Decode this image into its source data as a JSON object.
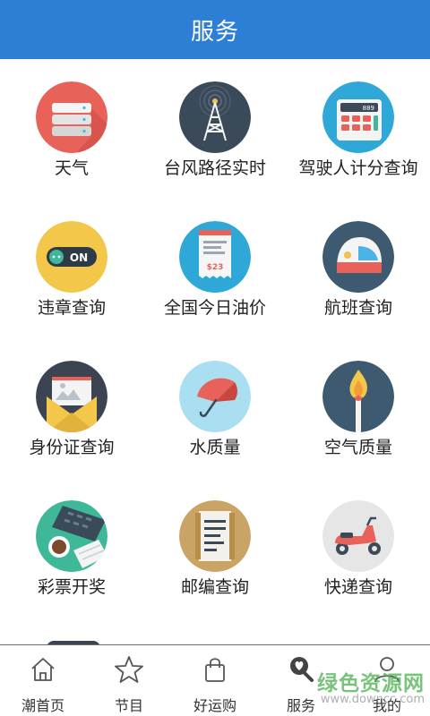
{
  "header": {
    "title": "服务"
  },
  "services": [
    {
      "label": "天气",
      "icon": "server-icon",
      "color": "#e8625a"
    },
    {
      "label": "台风路径实时",
      "icon": "radio-tower-icon",
      "color": "#3a4a58"
    },
    {
      "label": "驾驶人计分查询",
      "icon": "calculator-icon",
      "color": "#2fa8d8"
    },
    {
      "label": "违章查询",
      "icon": "toggle-on-icon",
      "color": "#f2c74a"
    },
    {
      "label": "全国今日油价",
      "icon": "receipt-icon",
      "color": "#2fa8d8"
    },
    {
      "label": "航班查询",
      "icon": "helmet-icon",
      "color": "#3d5a70"
    },
    {
      "label": "身份证查询",
      "icon": "envelope-icon",
      "color": "#3b4450"
    },
    {
      "label": "水质量",
      "icon": "umbrella-icon",
      "color": "#a9dff0"
    },
    {
      "label": "空气质量",
      "icon": "match-flame-icon",
      "color": "#3d5a70"
    },
    {
      "label": "彩票开奖",
      "icon": "keyboard-coffee-icon",
      "color": "#3fb899"
    },
    {
      "label": "邮编查询",
      "icon": "document-icon",
      "color": "#c9a465"
    },
    {
      "label": "快递查询",
      "icon": "scooter-icon",
      "color": "#e6e6e6"
    }
  ],
  "receipt_amount": "$23",
  "calc_display": "889",
  "toggle_text": "ON",
  "tabs": [
    {
      "label": "潮首页",
      "icon": "home-icon"
    },
    {
      "label": "节目",
      "icon": "star-icon"
    },
    {
      "label": "好运购",
      "icon": "shopping-bag-icon"
    },
    {
      "label": "服务",
      "icon": "heart-pin-icon",
      "active": true
    },
    {
      "label": "我的",
      "icon": "user-icon"
    }
  ],
  "watermark": {
    "title": "绿色资源网",
    "url": "www.downcc.com"
  }
}
